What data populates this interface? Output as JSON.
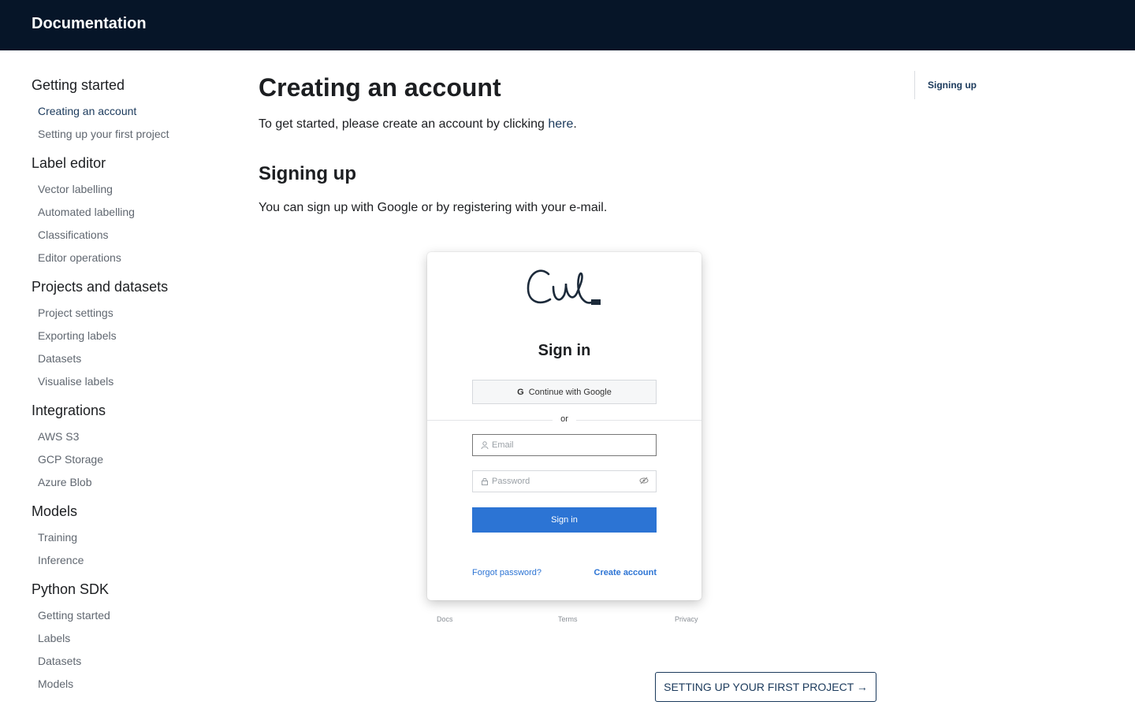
{
  "header": {
    "title": "Documentation"
  },
  "sidebar": {
    "groups": [
      {
        "title": "Getting started",
        "items": [
          "Creating an account",
          "Setting up your first project"
        ]
      },
      {
        "title": "Label editor",
        "items": [
          "Vector labelling",
          "Automated labelling",
          "Classifications",
          "Editor operations"
        ]
      },
      {
        "title": "Projects and datasets",
        "items": [
          "Project settings",
          "Exporting labels",
          "Datasets",
          "Visualise labels"
        ]
      },
      {
        "title": "Integrations",
        "items": [
          "AWS S3",
          "GCP Storage",
          "Azure Blob"
        ]
      },
      {
        "title": "Models",
        "items": [
          "Training",
          "Inference"
        ]
      },
      {
        "title": "Python SDK",
        "items": [
          "Getting started",
          "Labels",
          "Datasets",
          "Models"
        ]
      }
    ],
    "active_item": "Creating an account"
  },
  "main": {
    "title": "Creating an account",
    "intro_prefix": "To get started, please create an account by clicking ",
    "intro_link": "here",
    "intro_suffix": ".",
    "section_title": "Signing up",
    "section_text": "You can sign up with Google or by registering with your e-mail."
  },
  "screenshot": {
    "title": "Sign in",
    "google_button": "Continue with Google",
    "or_label": "or",
    "email_placeholder": "Email",
    "password_placeholder": "Password",
    "submit_label": "Sign in",
    "forgot_link": "Forgot password?",
    "create_link": "Create account",
    "footer": [
      "Docs",
      "Terms",
      "Privacy"
    ]
  },
  "pagination": {
    "next_label": "SETTING UP YOUR FIRST PROJECT →"
  },
  "toc": {
    "items": [
      "Signing up"
    ]
  },
  "colors": {
    "topbar": "#061528",
    "link": "#1b3a5c",
    "primary_button": "#2c74d4"
  }
}
